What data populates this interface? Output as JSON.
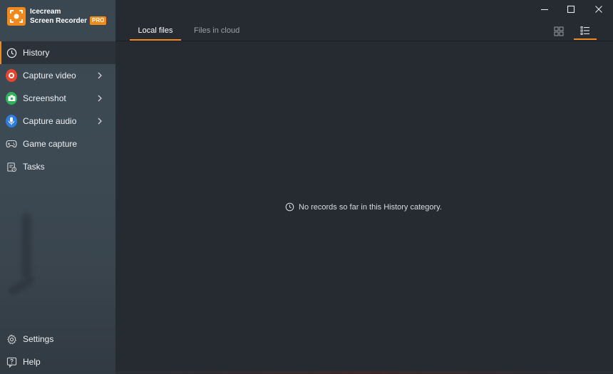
{
  "app": {
    "name_line1": "Icecream",
    "name_line2": "Screen Recorder",
    "badge": "PRO",
    "accent_color": "#f08a1c"
  },
  "sidebar": {
    "items": [
      {
        "label": "History",
        "icon": "clock-icon",
        "active": true
      },
      {
        "label": "Capture video",
        "icon": "record-icon",
        "color": "#e8452f",
        "has_submenu": true
      },
      {
        "label": "Screenshot",
        "icon": "camera-icon",
        "color": "#2fb35a",
        "has_submenu": true
      },
      {
        "label": "Capture audio",
        "icon": "microphone-icon",
        "color": "#2f7de0",
        "has_submenu": true
      },
      {
        "label": "Game capture",
        "icon": "gamepad-icon"
      },
      {
        "label": "Tasks",
        "icon": "tasks-icon"
      }
    ],
    "footer": [
      {
        "label": "Settings",
        "icon": "gear-icon"
      },
      {
        "label": "Help",
        "icon": "help-icon"
      }
    ]
  },
  "tabs": [
    {
      "label": "Local files",
      "active": true
    },
    {
      "label": "Files in cloud",
      "active": false
    }
  ],
  "view_modes": [
    {
      "name": "grid-view",
      "active": false
    },
    {
      "name": "list-view",
      "active": true
    }
  ],
  "window_controls": [
    "minimize",
    "maximize",
    "close"
  ],
  "empty_state": {
    "icon": "clock-icon",
    "message": "No records so far in this History category."
  }
}
